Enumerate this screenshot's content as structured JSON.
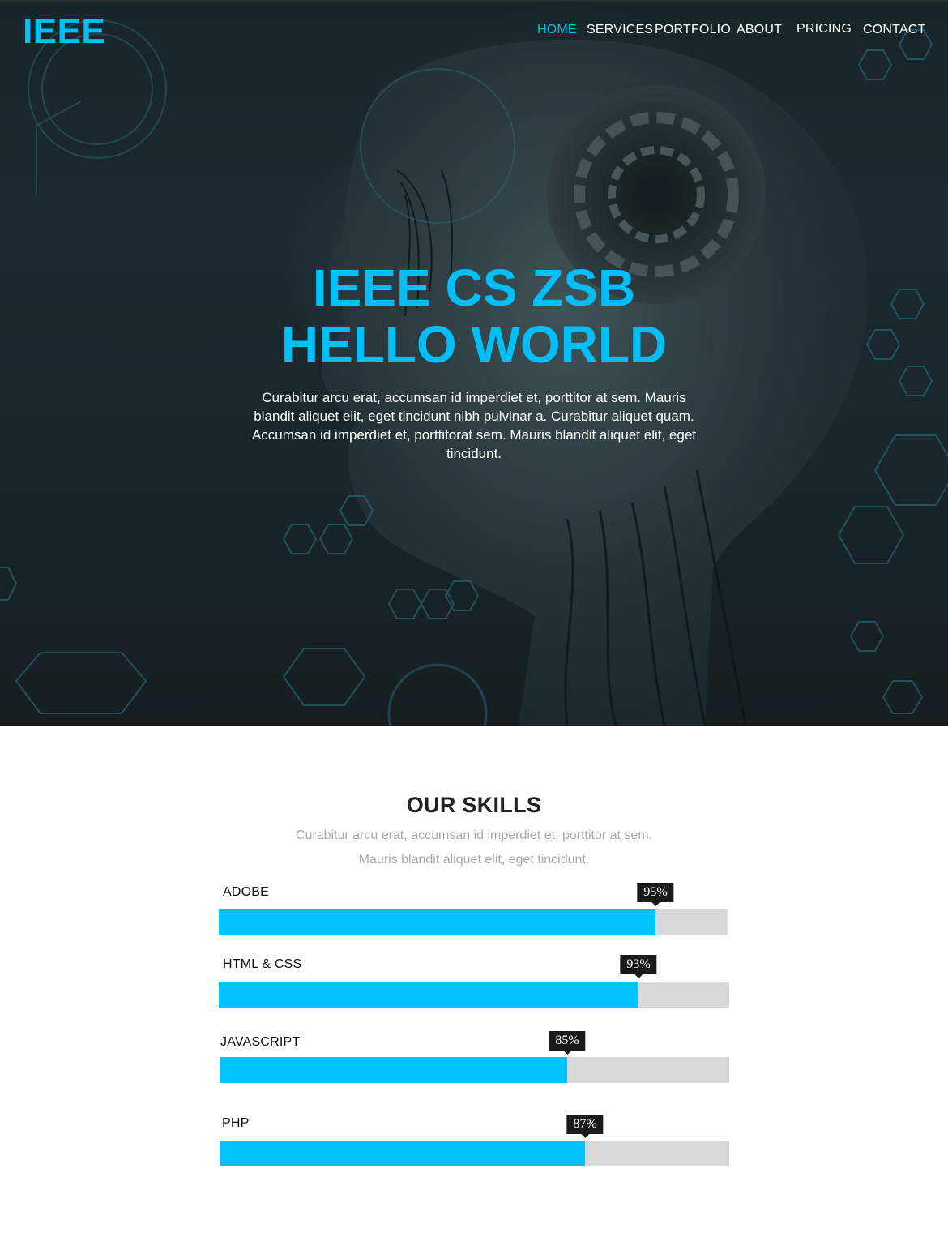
{
  "brand": {
    "logo": "IEEE",
    "accent_color": "#00bff8"
  },
  "nav": {
    "items": [
      {
        "label": "HOME",
        "active": true
      },
      {
        "label": "SERVICES",
        "active": false
      },
      {
        "label": "PORTFOLIO",
        "active": false
      },
      {
        "label": "ABOUT",
        "active": false
      },
      {
        "label": "PRICING",
        "active": false
      },
      {
        "label": "CONTACT",
        "active": false
      }
    ]
  },
  "hero": {
    "title_line1": "IEEE CS ZSB",
    "title_line2": "HELLO WORLD",
    "text": "Curabitur arcu erat, accumsan id imperdiet et, porttitor at sem. Mauris blandit aliquet elit,  eget tincidunt nibh pulvinar a. Curabitur aliquet quam. Accumsan id imperdiet et, porttitorat  sem. Mauris blandit aliquet elit, eget tincidunt."
  },
  "skills": {
    "title": "OUR SKILLS",
    "subtitle": "Curabitur arcu erat, accumsan id imperdiet et, porttitor at sem. Mauris blandit aliquet elit, eget tincidunt.",
    "fill_color": "#00c4fb",
    "track_color": "#d9d9d9",
    "items": [
      {
        "label": "ADOBE",
        "percent": 95,
        "percent_label": "95%"
      },
      {
        "label": "HTML & CSS",
        "percent": 93,
        "percent_label": "93%"
      },
      {
        "label": "JAVASCRIPT",
        "percent": 85,
        "percent_label": "85%"
      },
      {
        "label": "PHP",
        "percent": 87,
        "percent_label": "87%"
      }
    ]
  }
}
